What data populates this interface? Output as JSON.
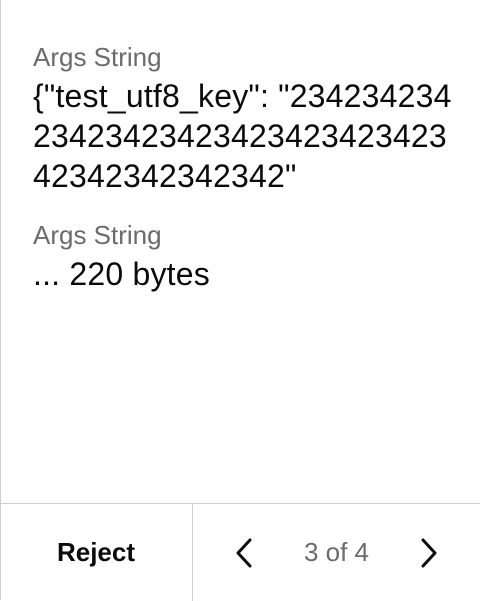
{
  "fields": [
    {
      "label": "Args String",
      "value": "{\"test_utf8_key\": \"2342342342342342342342342342342342342342342342\""
    },
    {
      "label": "Args String",
      "value": "... 220 bytes"
    }
  ],
  "footer": {
    "reject_label": "Reject",
    "pager_text": "3 of 4",
    "prev_icon": "chevron-left-icon",
    "next_icon": "chevron-right-icon"
  }
}
